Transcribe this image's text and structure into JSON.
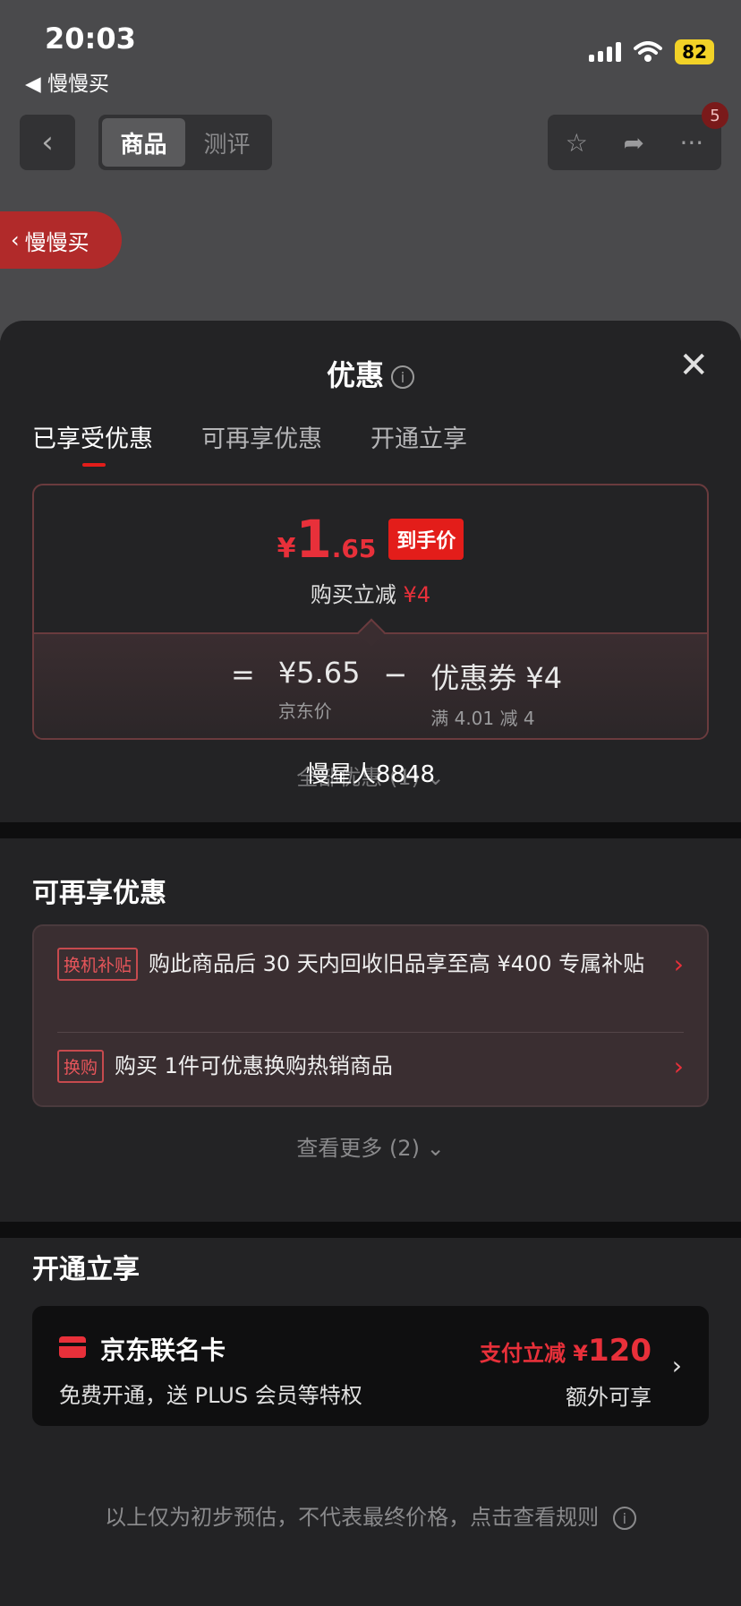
{
  "status_bar": {
    "time": "20:03",
    "back_app": "◀ 慢慢买",
    "battery": "82"
  },
  "nav": {
    "back_icon": "chevron-left-icon",
    "tabs": [
      {
        "label": "商品",
        "active": true
      },
      {
        "label": "测评",
        "active": false
      }
    ],
    "badge_count": "5"
  },
  "slow_buy_button": "慢慢买",
  "sheet": {
    "title": "优惠",
    "close_icon": "close-icon",
    "tabs": [
      {
        "label": "已享受优惠",
        "active": true
      },
      {
        "label": "可再享优惠",
        "active": false
      },
      {
        "label": "开通立享",
        "active": false
      }
    ],
    "price": {
      "currency": "¥",
      "integer": "1",
      "decimal": ".65",
      "tag": "到手价",
      "direct_cut_label": "购买立减",
      "direct_cut_value": "¥4"
    },
    "formula": {
      "equals": "=",
      "jd_price": "¥5.65",
      "jd_price_label": "京东价",
      "minus": "−",
      "coupon": "优惠券 ¥4",
      "coupon_label": "满 4.01 减 4"
    },
    "all_discounts": "全部优惠 (1)",
    "watermark": "慢星人8848"
  },
  "more_section": {
    "title": "可再享优惠",
    "items": [
      {
        "tag": "换机补贴",
        "text": "购此商品后 30 天内回收旧品享至高 ¥400 专属补贴"
      },
      {
        "tag": "换购",
        "text": "购买 1件可优惠换购热销商品"
      }
    ],
    "see_more": "查看更多 (2)"
  },
  "open_section": {
    "title": "开通立享",
    "card": {
      "title": "京东联名卡",
      "desc": "免费开通，送 PLUS 会员等特权",
      "promo_label": "支付立减 ¥",
      "promo_amount": "120",
      "extra": "额外可享"
    }
  },
  "footer": {
    "note": "以上仅为初步预估，不代表最终价格，点击查看规则"
  },
  "colors": {
    "accent_red": "#e31d1a",
    "sheet_bg": "#232325",
    "card_border": "#6a3b3e"
  }
}
